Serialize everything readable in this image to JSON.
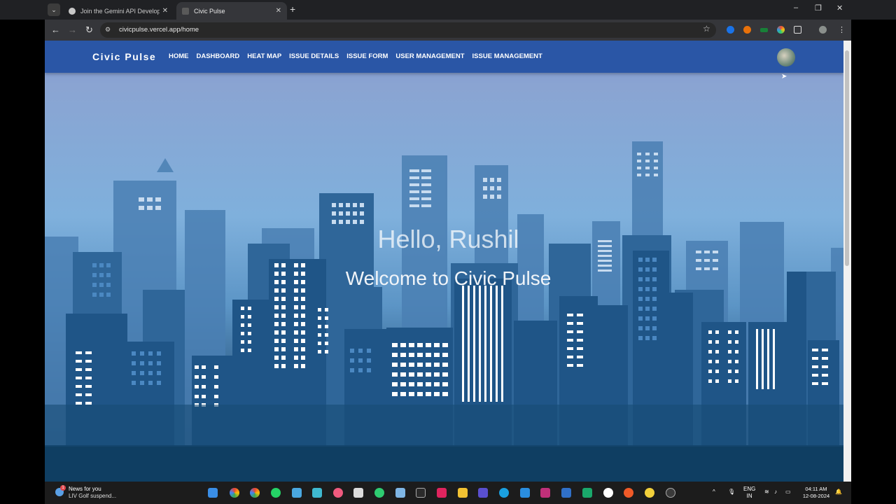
{
  "browser": {
    "tabs": [
      {
        "label": "Join the Gemini API Developer",
        "active": false
      },
      {
        "label": "Civic Pulse",
        "active": true
      }
    ],
    "new_tab": "+",
    "url": "civicpulse.vercel.app/home",
    "nav_back": "←",
    "nav_forward": "→",
    "reload": "↻",
    "minimize": "–",
    "maximize": "❐",
    "close": "✕",
    "tab_menu": "⌄",
    "bookmark": "☆",
    "more": "⋮"
  },
  "app": {
    "brand": "Civic Pulse",
    "nav": [
      "HOME",
      "DASHBOARD",
      "HEAT MAP",
      "ISSUE DETAILS",
      "ISSUE FORM",
      "USER MANAGEMENT",
      "ISSUE MANAGEMENT"
    ]
  },
  "hero": {
    "greeting": "Hello, Rushil",
    "welcome": "Welcome to Civic Pulse"
  },
  "taskbar": {
    "news_title": "News for you",
    "news_subtitle": "LIV Golf suspend...",
    "news_badge": "1",
    "lang_top": "ENG",
    "lang_bottom": "IN",
    "time": "04:11 AM",
    "date": "12-08-2024",
    "tray_up": "^"
  },
  "colors": {
    "navbar": "#2a56a6",
    "sky_top": "#7a92cc",
    "ground": "#0f3e62"
  }
}
